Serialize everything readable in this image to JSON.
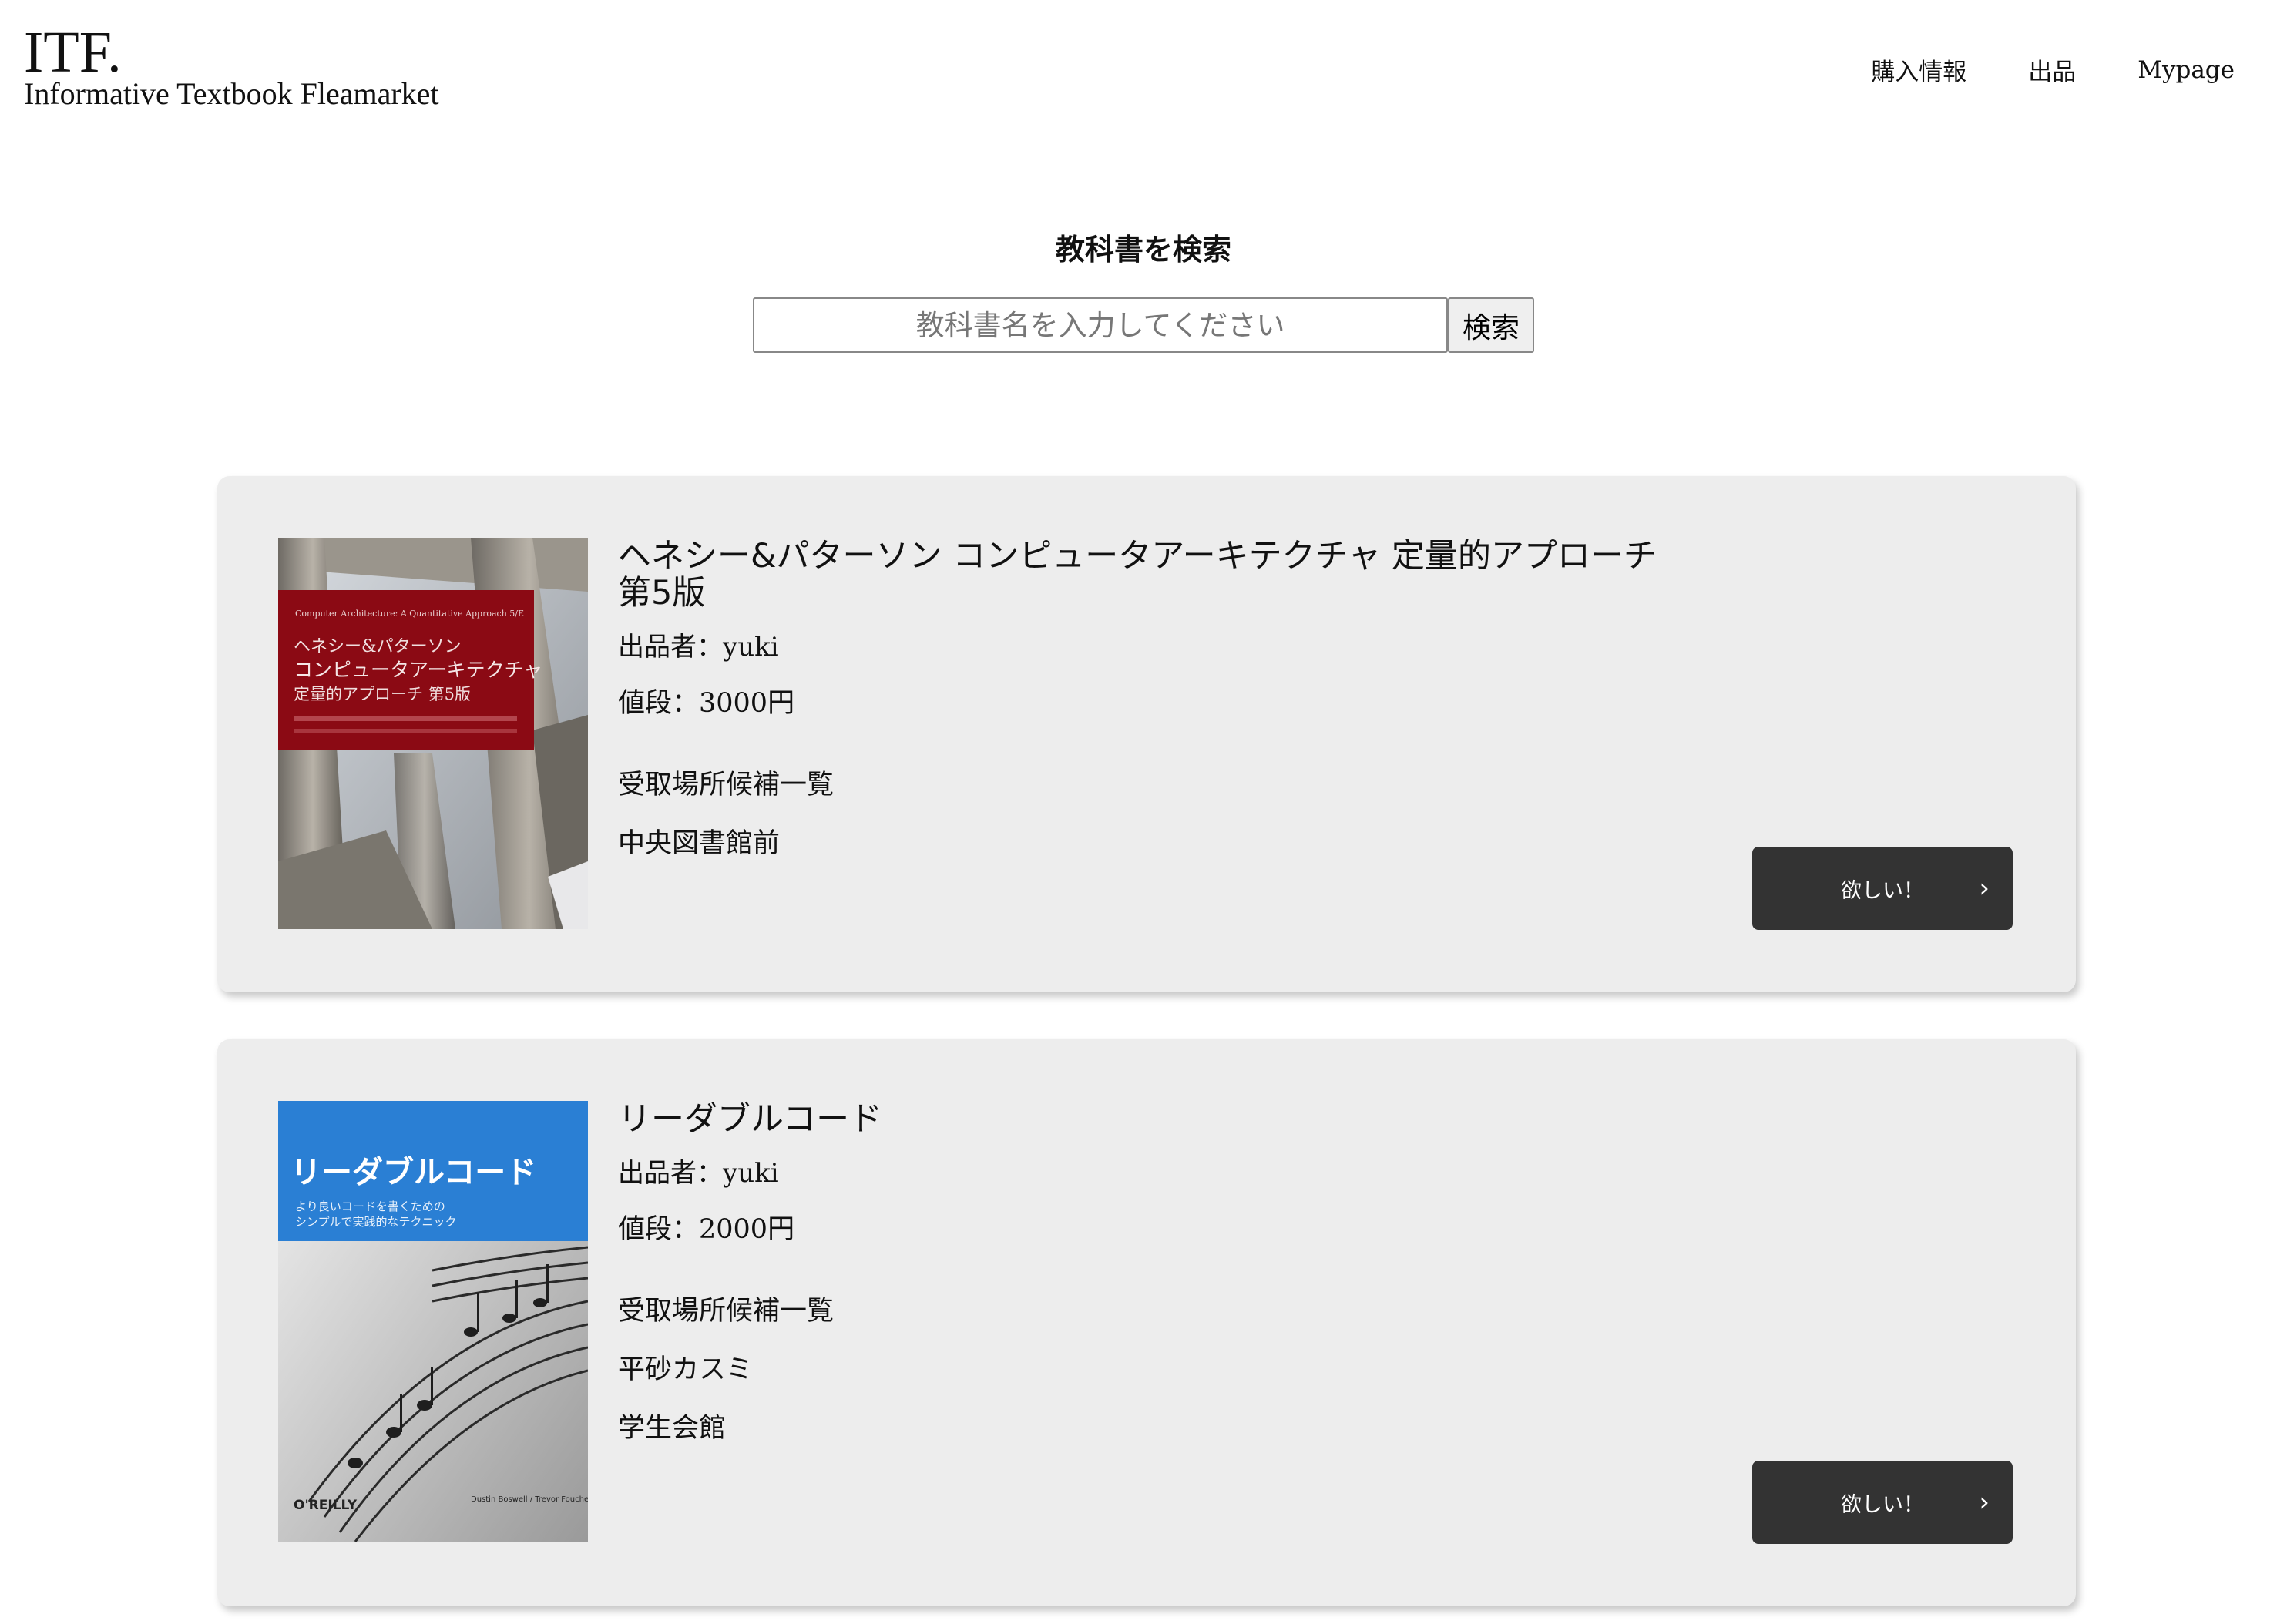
{
  "header": {
    "logo": "ITF.",
    "subtitle": "Informative Textbook Fleamarket",
    "nav": [
      {
        "label": "購入情報"
      },
      {
        "label": "出品"
      },
      {
        "label": "Mypage"
      }
    ]
  },
  "search": {
    "heading": "教科書を検索",
    "placeholder": "教科書名を入力してください",
    "button_label": "検索"
  },
  "listings": [
    {
      "title": "ヘネシー&パターソン コンピュータアーキテクチャ 定量的アプローチ 第5版",
      "seller": "出品者：yuki",
      "price": "値段：3000円",
      "pickup_heading": "受取場所候補一覧",
      "pickup_places": [
        "中央図書館前"
      ],
      "button_label": "欲しい！",
      "cover": {
        "top_text": "Computer Architecture: A Quantitative Approach 5/E",
        "line1": "ヘネシー&パターソン",
        "line2": "コンピュータアーキテクチャ",
        "line3": "定量的アプローチ 第5版",
        "color": "#8b0a14"
      }
    },
    {
      "title": "リーダブルコード",
      "seller": "出品者：yuki",
      "price": "値段：2000円",
      "pickup_heading": "受取場所候補一覧",
      "pickup_places": [
        "平砂カスミ",
        "学生会館"
      ],
      "button_label": "欲しい！",
      "cover": {
        "title": "リーダブルコード",
        "sub1": "より良いコードを書くための",
        "sub2": "シンプルで実践的なテクニック",
        "publisher": "O'REILLY",
        "authors": "Dustin Boswell / Trevor Foucher",
        "color": "#2a7fd4"
      }
    }
  ],
  "colors": {
    "card_bg": "#ededed",
    "button_bg": "#333333",
    "accent_red": "#8b0a14",
    "accent_blue": "#2a7fd4"
  }
}
